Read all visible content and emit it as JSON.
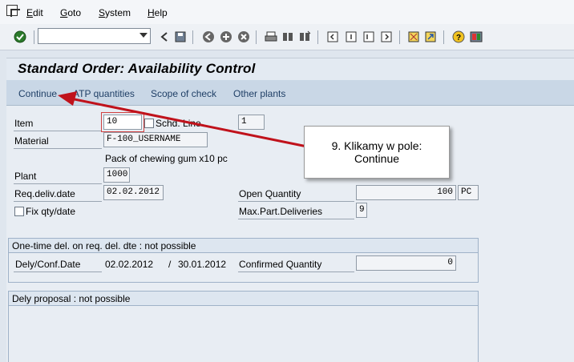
{
  "menu": {
    "items": [
      {
        "first": "E",
        "rest": "dit"
      },
      {
        "first": "G",
        "rest": "oto"
      },
      {
        "first": "S",
        "rest": "ystem"
      },
      {
        "first": "H",
        "rest": "elp"
      }
    ]
  },
  "toolbar": {
    "command_field": "",
    "icons": [
      "enter-check-icon",
      "back-icon",
      "save-icon",
      "back-green-icon",
      "exit-icon",
      "cancel-icon",
      "print-icon",
      "find-icon",
      "find-next-icon",
      "first-page-icon",
      "previous-page-icon",
      "next-page-icon",
      "last-page-icon",
      "create-session-icon",
      "shortcut-icon",
      "help-icon",
      "layout-icon"
    ]
  },
  "title": "Standard Order: Availability Control",
  "app_toolbar": {
    "continue": "Continue",
    "atp_quantities": "ATP quantities",
    "scope_of_check": "Scope of check",
    "other_plants": "Other plants"
  },
  "form": {
    "item_label": "Item",
    "item_value": "10",
    "sched_line_label": "Schd. Line",
    "sched_line_value": "1",
    "material_label": "Material",
    "material_value": "F-100_USERNAME",
    "material_desc": "Pack of chewing gum x10 pc",
    "plant_label": "Plant",
    "plant_value": "1000",
    "req_deliv_date_label": "Req.deliv.date",
    "req_deliv_date_value": "02.02.2012",
    "open_quantity_label": "Open Quantity",
    "open_quantity_value": "100",
    "open_quantity_unit": "PC",
    "fix_qty_label": "Fix qty/date",
    "max_part_deliveries_label": "Max.Part.Deliveries",
    "max_part_deliveries_value": "9"
  },
  "one_time": {
    "title": "One-time del. on req. del. dte : not possible",
    "dely_conf_label": "Dely/Conf.Date",
    "dely_date": "02.02.2012",
    "slash": "/",
    "conf_date": "30.01.2012",
    "confirmed_qty_label": "Confirmed Quantity",
    "confirmed_qty_value": "0"
  },
  "dely_proposal": {
    "title": "Dely proposal : not possible"
  },
  "callout": {
    "line1": "9. Klikamy w pole:",
    "line2": "Continue"
  },
  "colors": {
    "arrow": "#c0121b",
    "app_toolbar_bg": "#c9d7e6",
    "content_bg": "#e8edf3"
  }
}
